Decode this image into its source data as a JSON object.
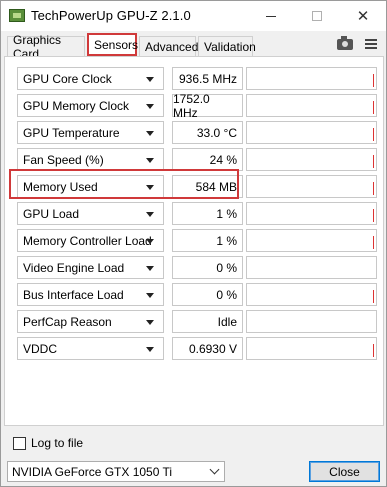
{
  "window": {
    "title": "TechPowerUp GPU-Z 2.1.0",
    "controls": {
      "minimize_icon": "minimize-icon",
      "maximize_icon": "maximize-icon",
      "close_glyph": "✕"
    }
  },
  "tabs": [
    {
      "label": "Graphics Card",
      "active": false
    },
    {
      "label": "Sensors",
      "active": true
    },
    {
      "label": "Advanced",
      "active": false
    },
    {
      "label": "Validation",
      "active": false
    }
  ],
  "toolbar_icons": [
    "camera-icon",
    "menu-icon"
  ],
  "sensors": [
    {
      "name": "GPU Core Clock",
      "value": "936.5 MHz",
      "graph_marker": true
    },
    {
      "name": "GPU Memory Clock",
      "value": "1752.0 MHz",
      "graph_marker": true
    },
    {
      "name": "GPU Temperature",
      "value": "33.0 °C",
      "graph_marker": true
    },
    {
      "name": "Fan Speed (%)",
      "value": "24 %",
      "graph_marker": true
    },
    {
      "name": "Memory Used",
      "value": "584 MB",
      "graph_marker": true,
      "highlighted": true
    },
    {
      "name": "GPU Load",
      "value": "1 %",
      "graph_marker": true
    },
    {
      "name": "Memory Controller Load",
      "value": "1 %",
      "graph_marker": true
    },
    {
      "name": "Video Engine Load",
      "value": "0 %",
      "graph_marker": false
    },
    {
      "name": "Bus Interface Load",
      "value": "0 %",
      "graph_marker": true
    },
    {
      "name": "PerfCap Reason",
      "value": "Idle",
      "graph_marker": false
    },
    {
      "name": "VDDC",
      "value": "0.6930 V",
      "graph_marker": true
    }
  ],
  "footer": {
    "log_label": "Log to file",
    "log_checked": false,
    "gpu_select": "NVIDIA GeForce GTX 1050 Ti",
    "close_label": "Close"
  },
  "colors": {
    "highlight": "#d0393a",
    "graph_marker": "#dd3333"
  }
}
